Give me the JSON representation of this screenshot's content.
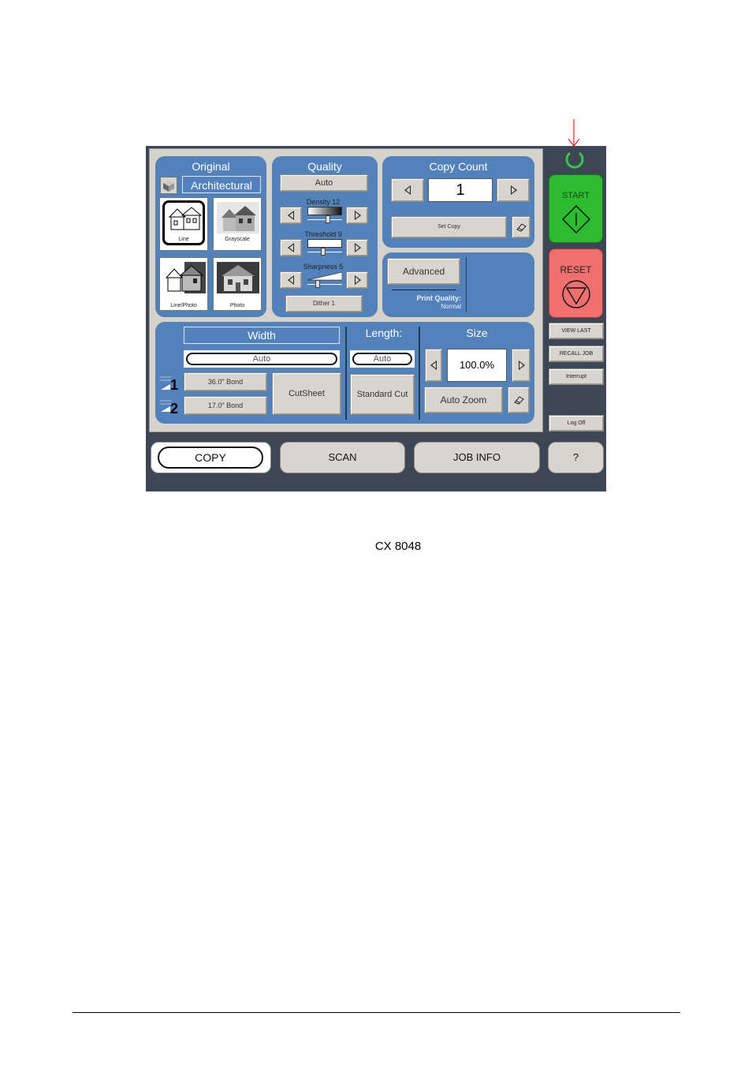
{
  "screen": {
    "original": {
      "title": "Original",
      "media_type": "Architectural",
      "modes": [
        {
          "label": "Line"
        },
        {
          "label": "Grayscale"
        },
        {
          "label": "Line/Photo"
        },
        {
          "label": "Photo"
        }
      ]
    },
    "quality": {
      "title": "Quality",
      "mode": "Auto",
      "density_label": "Density 12",
      "threshold_label": "Threshold 9",
      "sharpness_label": "Sharpness 5",
      "dither_label": "Dither 1",
      "density_level": 12,
      "threshold_level": 9,
      "sharpness_level": 5
    },
    "copy_count": {
      "title": "Copy Count",
      "value": "1",
      "set_copy_label": "Set Copy"
    },
    "advanced": {
      "button_label": "Advanced",
      "print_quality_label": "Print Quality:",
      "print_quality_value": "Normal"
    },
    "width": {
      "title": "Width",
      "value": "Auto",
      "roll1_label": "36.0\" Bond",
      "roll2_label": "17.0\" Bond",
      "roll1_num": "1",
      "roll2_num": "2",
      "cutsheet_label": "CutSheet"
    },
    "length": {
      "title": "Length:",
      "value": "Auto",
      "standard_cut_label": "Standard Cut"
    },
    "size": {
      "title": "Size",
      "value": "100.0%",
      "auto_zoom_label": "Auto Zoom"
    },
    "side": {
      "start_label": "START",
      "reset_label": "RESET",
      "view_last_label": "VIEW LAST",
      "recall_job_label": "RECALL JOB",
      "interrupt_label": "Interrupt",
      "log_off_label": "Log Off"
    },
    "tabs": [
      {
        "label": "COPY",
        "active": true
      },
      {
        "label": "SCAN"
      },
      {
        "label": "JOB INFO"
      },
      {
        "label": "?"
      }
    ]
  },
  "caption": "CX 8048",
  "colors": {
    "panel_blue": "#5282b9",
    "start_green": "#2dbb2f",
    "reset_red": "#f06f6f",
    "frame_dark": "#3c4654",
    "ready_ring": "#3ec34a",
    "pointer_arrow": "#e02020"
  }
}
